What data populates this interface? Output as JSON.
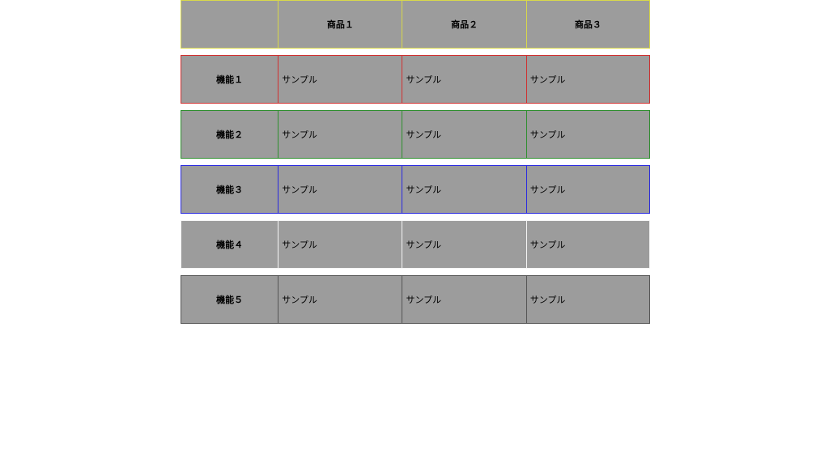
{
  "table": {
    "header_border": "yellow",
    "columns": [
      "",
      "商品１",
      "商品２",
      "商品３"
    ],
    "rows": [
      {
        "border": "red",
        "label": "機能１",
        "cells": [
          "サンプル",
          "サンプル",
          "サンプル"
        ]
      },
      {
        "border": "green",
        "label": "機能２",
        "cells": [
          "サンプル",
          "サンプル",
          "サンプル"
        ]
      },
      {
        "border": "blue",
        "label": "機能３",
        "cells": [
          "サンプル",
          "サンプル",
          "サンプル"
        ]
      },
      {
        "border": "white",
        "label": "機能４",
        "cells": [
          "サンプル",
          "サンプル",
          "サンプル"
        ]
      },
      {
        "border": "gray",
        "label": "機能５",
        "cells": [
          "サンプル",
          "サンプル",
          "サンプル"
        ]
      }
    ]
  },
  "colors": {
    "cell_bg": "#9c9c9c",
    "yellow": "#d8d84a",
    "red": "#d03030",
    "green": "#2f8f2f",
    "blue": "#2a2ae0",
    "white": "#f5f5f5",
    "gray": "#555555"
  }
}
